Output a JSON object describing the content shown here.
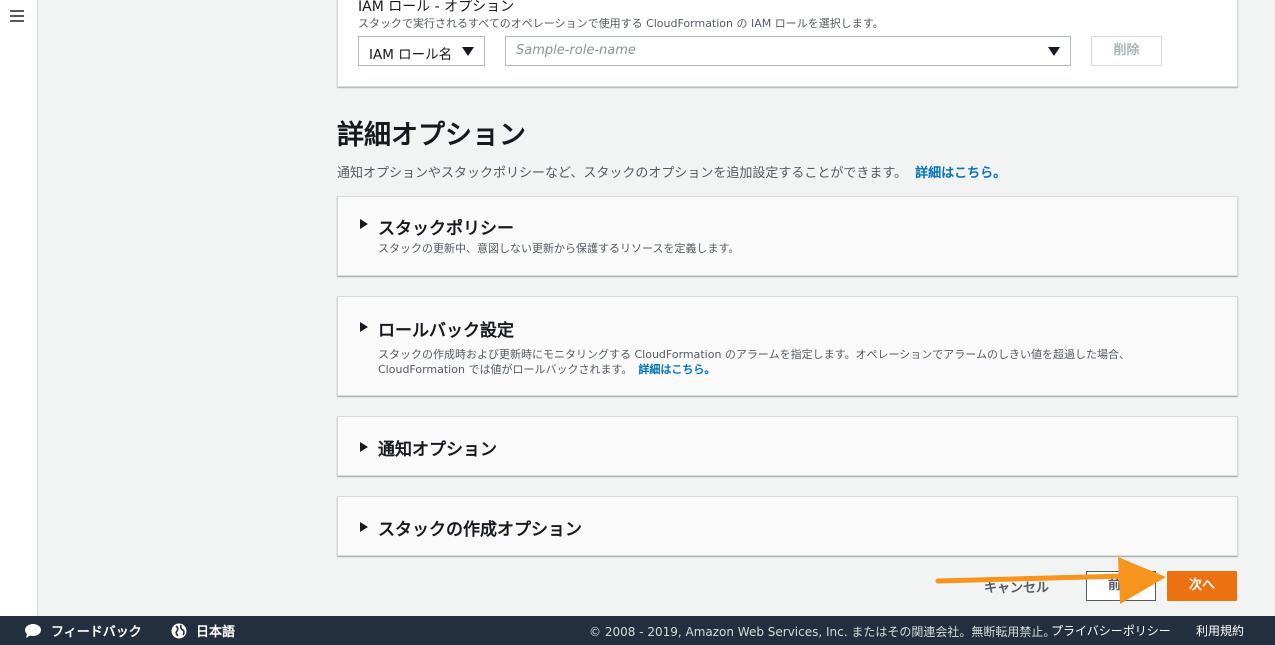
{
  "iam": {
    "title": "IAM ロール - オプション",
    "description": "スタックで実行されるすべてのオペレーションで使用する CloudFormation の IAM ロールを選択します。",
    "role_type_value": "IAM ロール名",
    "role_name_placeholder": "Sample-role-name",
    "delete_label": "削除"
  },
  "advanced": {
    "title": "詳細オプション",
    "description": "通知オプションやスタックポリシーなど、スタックのオプションを追加設定することができます。",
    "learn_more": "詳細はこちら。"
  },
  "sections": [
    {
      "title": "スタックポリシー",
      "description": "スタックの更新中、意図しない更新から保護するリソースを定義します。"
    },
    {
      "title": "ロールバック設定",
      "description_line1": "スタックの作成時および更新時にモニタリングする CloudFormation のアラームを指定します。オペレーションでアラームのしきい値を超過した場合、",
      "description_line2": "CloudFormation では値がロールバックされます。",
      "learn_more": "詳細はこちら。"
    },
    {
      "title": "通知オプション"
    },
    {
      "title": "スタックの作成オプション"
    }
  ],
  "actions": {
    "cancel": "キャンセル",
    "previous": "前へ",
    "next": "次へ"
  },
  "footer": {
    "feedback": "フィードバック",
    "language": "日本語",
    "copyright": "© 2008 - 2019, Amazon Web Services, Inc. またはその関連会社。無断転用禁止。",
    "privacy": "プライバシーポリシー",
    "terms": "利用規約"
  },
  "colors": {
    "primary_button": "#ec7211",
    "link": "#0073bb",
    "footer_bg": "#232f3e",
    "annotation_arrow": "#f7941d"
  }
}
